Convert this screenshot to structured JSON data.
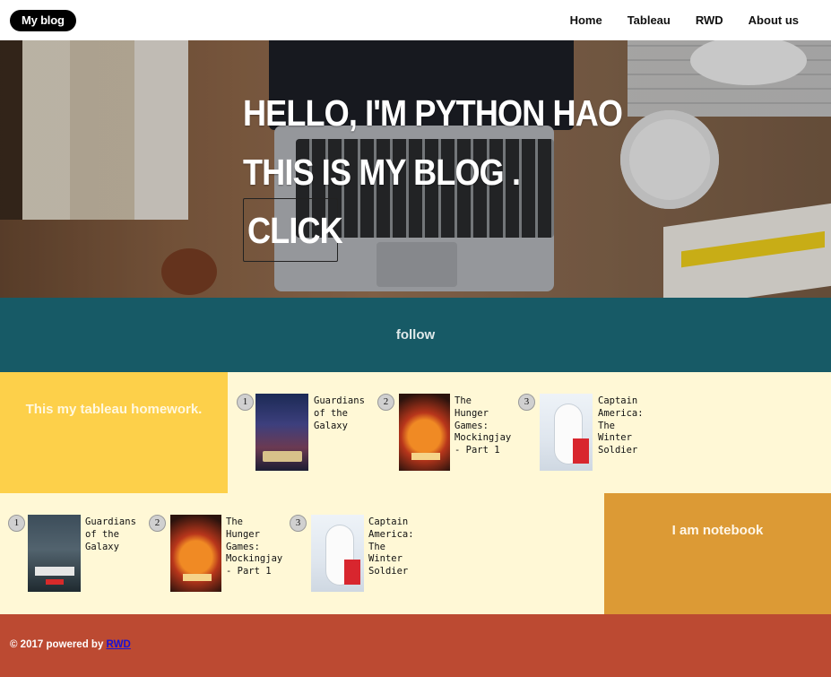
{
  "nav": {
    "brand": "My blog",
    "items": [
      {
        "label": "Home"
      },
      {
        "label": "Tableau"
      },
      {
        "label": "RWD"
      },
      {
        "label": "About us"
      }
    ]
  },
  "hero": {
    "line1": "HELLO, I'M PYTHON HAO",
    "line2": "THIS IS MY BLOG .",
    "button": "CLICK"
  },
  "follow": {
    "label": "follow"
  },
  "section1": {
    "label": "This my tableau homework.",
    "movies": [
      {
        "rank": "1",
        "title": "Guardians of the Galaxy",
        "poster_icon": "guardians-poster"
      },
      {
        "rank": "2",
        "title": "The Hunger Games: Mockingjay - Part 1",
        "poster_icon": "mockingjay-poster"
      },
      {
        "rank": "3",
        "title": "Captain America: The Winter Soldier",
        "poster_icon": "big-hero-6-poster"
      }
    ]
  },
  "section2": {
    "label": "I am notebook",
    "movies": [
      {
        "rank": "1",
        "title": "Guardians of the Galaxy",
        "poster_icon": "planet-of-the-apes-poster"
      },
      {
        "rank": "2",
        "title": "The Hunger Games: Mockingjay - Part 1",
        "poster_icon": "mockingjay-poster"
      },
      {
        "rank": "3",
        "title": "Captain America: The Winter Soldier",
        "poster_icon": "big-hero-6-poster"
      }
    ]
  },
  "footer": {
    "prefix": "© 2017 powered by ",
    "link": "RWD"
  },
  "colors": {
    "follow_bg": "#175a66",
    "yellow_box": "#fdd04a",
    "orange_box": "#dc9a35",
    "row_bg": "#fff8d6",
    "footer_bg": "#bc4a32",
    "link": "#1a12d6"
  }
}
